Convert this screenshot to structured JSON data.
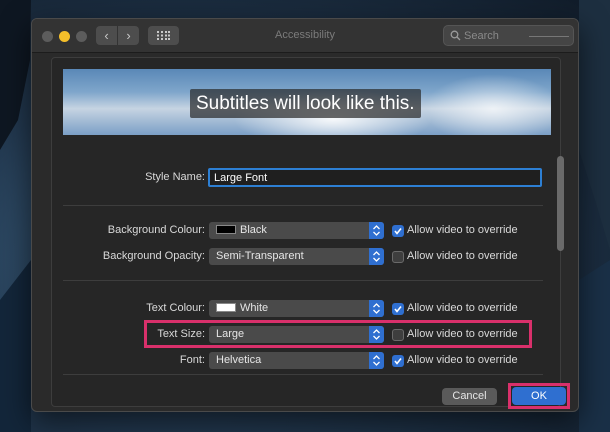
{
  "window": {
    "title": "Accessibility"
  },
  "toolbar": {
    "search_placeholder": "Search"
  },
  "preview": {
    "subtitle": "Subtitles will look like this."
  },
  "style_name": {
    "label": "Style Name:",
    "value": "Large Font"
  },
  "rows": [
    {
      "label": "Background Colour:",
      "value": "Black",
      "swatch": "#000000",
      "override_label": "Allow video to override",
      "override_checked": true
    },
    {
      "label": "Background Opacity:",
      "value": "Semi-Transparent",
      "override_label": "Allow video to override",
      "override_checked": false
    },
    {
      "label": "Text Colour:",
      "value": "White",
      "swatch": "#ffffff",
      "override_label": "Allow video to override",
      "override_checked": true
    },
    {
      "label": "Text Size:",
      "value": "Large",
      "override_label": "Allow video to override",
      "override_checked": false
    },
    {
      "label": "Font:",
      "value": "Helvetica",
      "override_label": "Allow video to override",
      "override_checked": true
    }
  ],
  "buttons": {
    "cancel": "Cancel",
    "ok": "OK"
  },
  "colors": {
    "accent": "#2f6fd0",
    "highlight": "#d9306b",
    "focus_ring": "#2d7fd3"
  }
}
